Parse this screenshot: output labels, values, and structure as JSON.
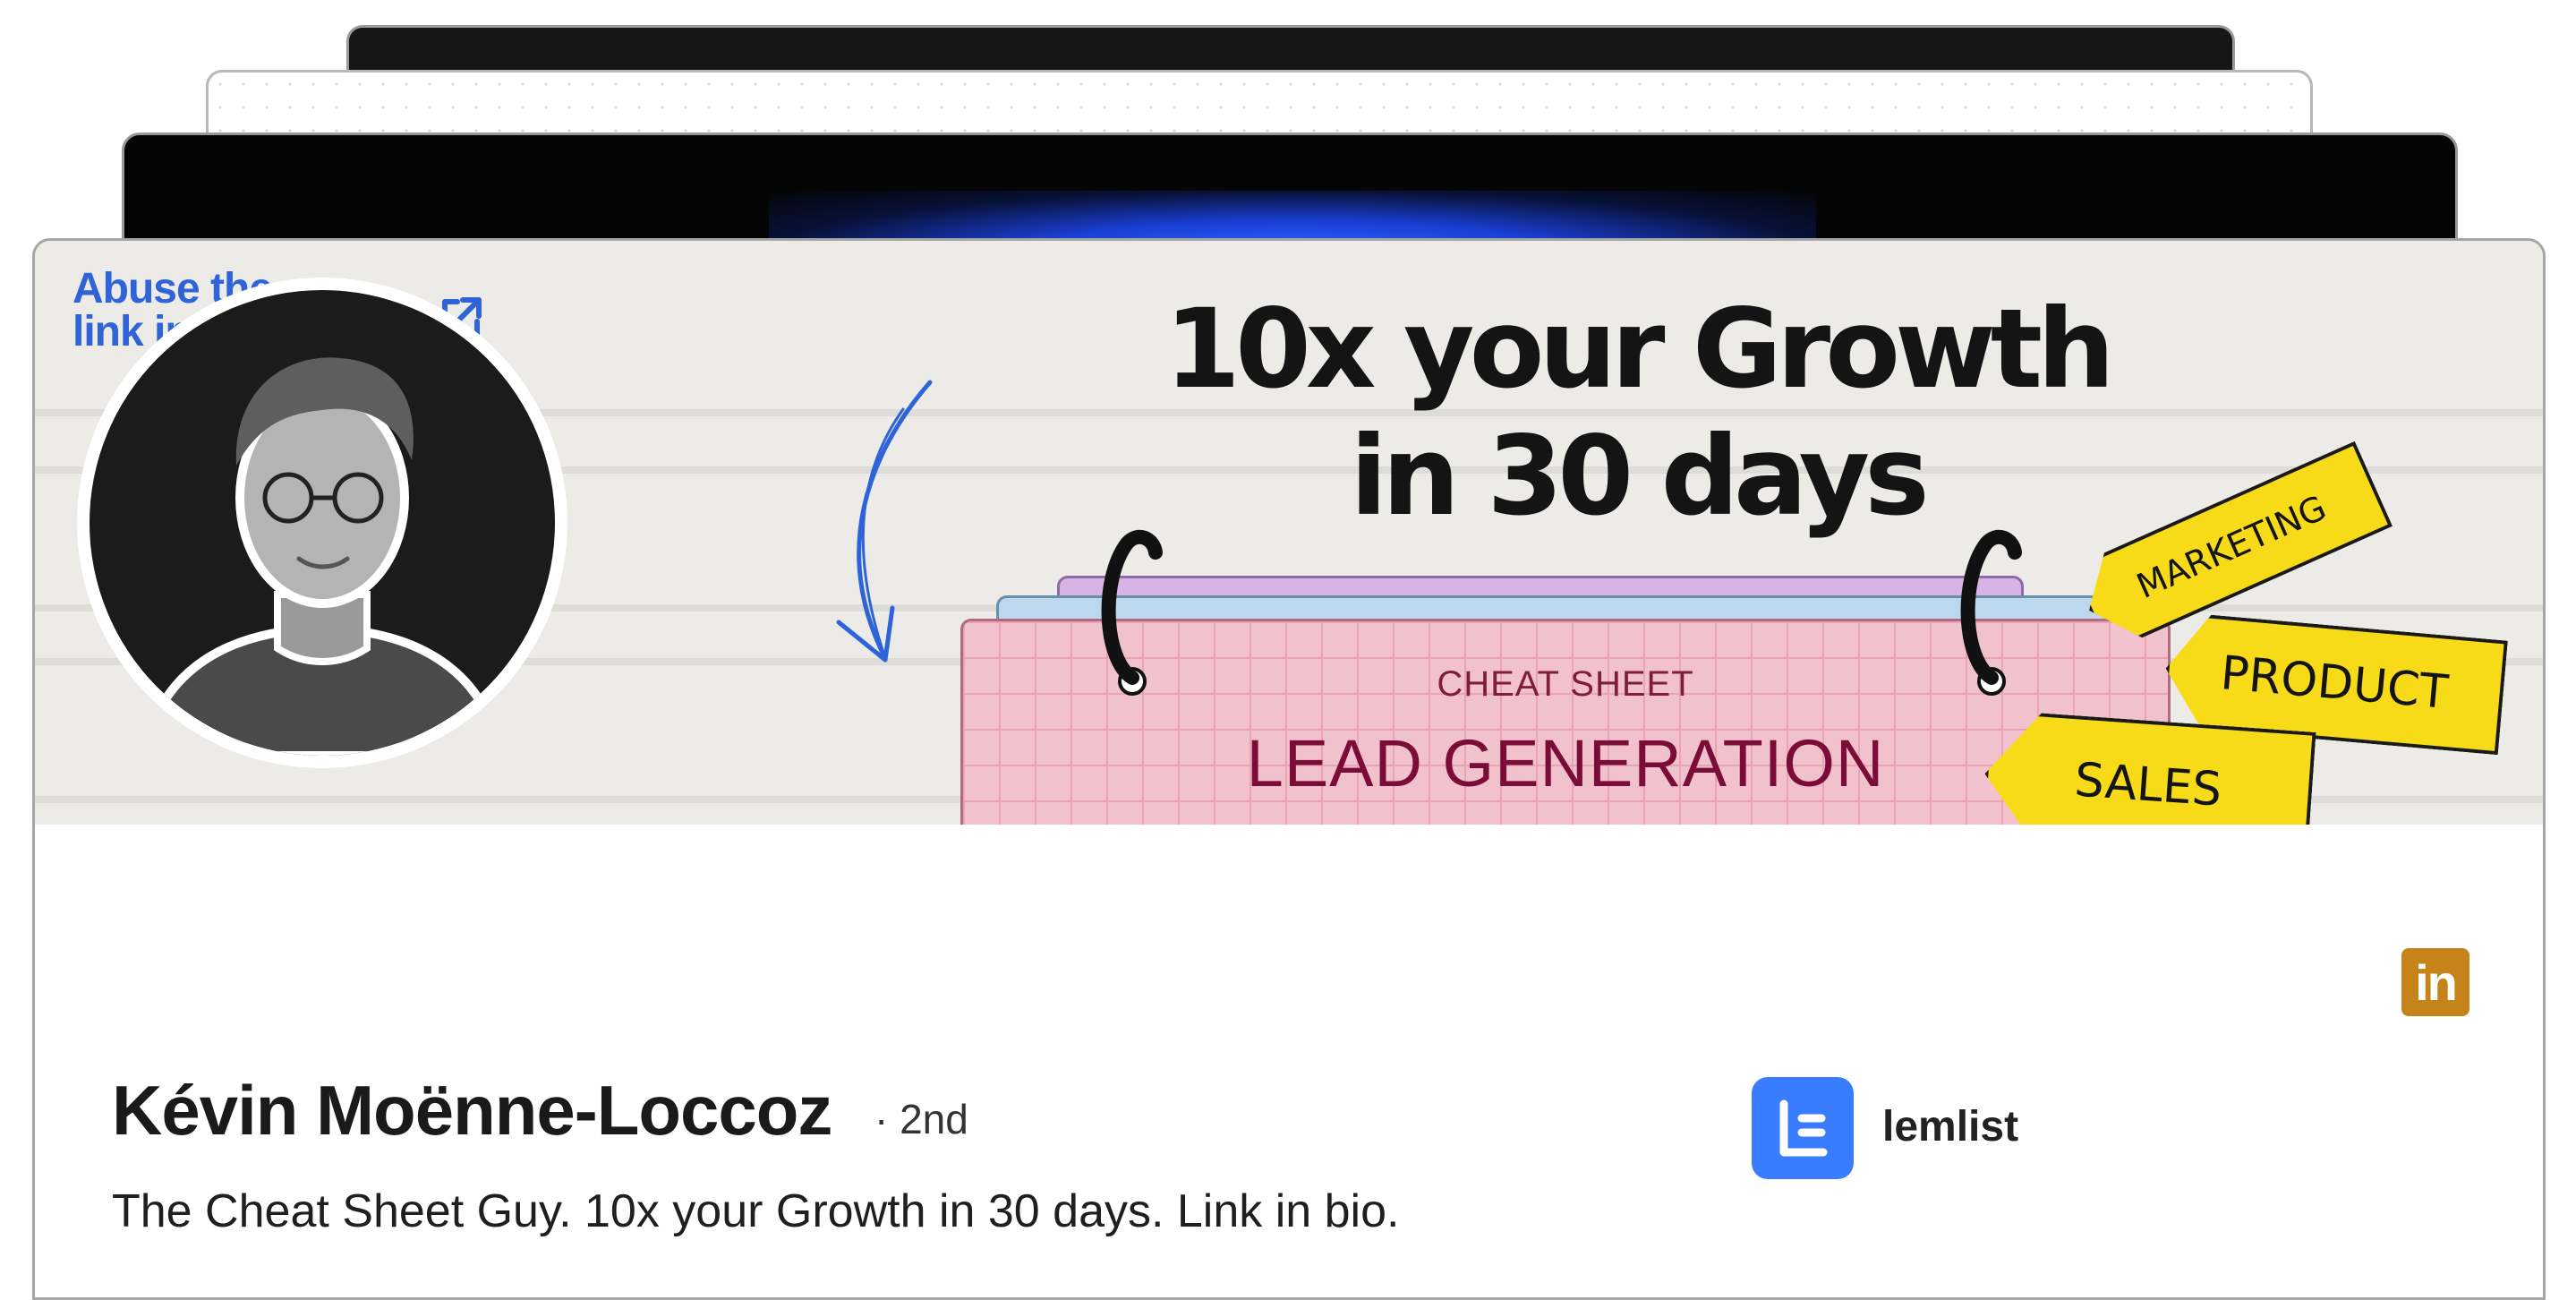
{
  "banner": {
    "bio_link_line1": "Abuse the",
    "bio_link_line2": "link in my bio",
    "headline_line1": "10x your Growth",
    "headline_line2": "in 30 days",
    "pad_subtitle": "CHEAT SHEET",
    "pad_title": "LEAD GENERATION",
    "tags": [
      "MARKETING",
      "PRODUCT",
      "SALES"
    ]
  },
  "profile": {
    "name": "Kévin Moënne-Loccoz",
    "degree": "· 2nd",
    "headline": "The Cheat Sheet Guy. 10x your Growth in 30 days. Link in bio.",
    "company": "lemlist",
    "linkedin_badge": "in"
  },
  "icons": {
    "external_link": "external-link-icon",
    "arrow": "curved-arrow-icon",
    "linkedin": "linkedin-icon",
    "company_logo": "lemlist-logo"
  },
  "colors": {
    "bio_link": "#2f63d8",
    "linkedin_badge": "#c58319",
    "company_logo": "#3a7cff",
    "tag_yellow": "#f8db18",
    "pad_pink": "#f1c2cd"
  }
}
